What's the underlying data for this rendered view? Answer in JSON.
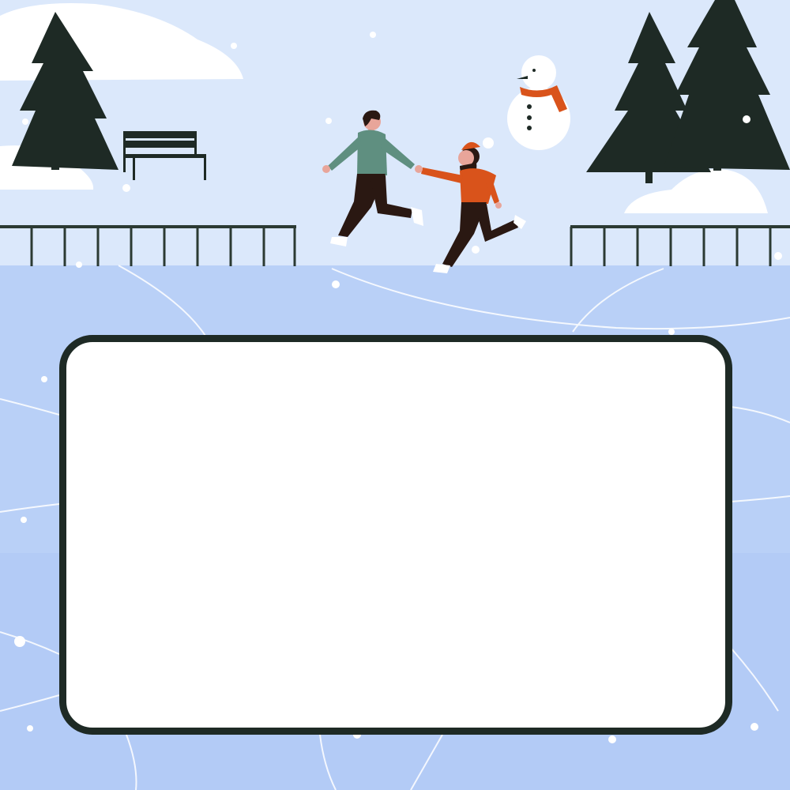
{
  "scene": {
    "sky_color": "#dbe8fb",
    "ice_color": "#b9d0f7",
    "snow_color": "#ffffff",
    "tree_color": "#1e2a25",
    "fence_color": "#2b3a33",
    "skater_male_sweater": "#5f8f80",
    "skater_female_sweater": "#d9531b",
    "pants_color": "#2a1812",
    "snowman_scarf": "#d9531b"
  },
  "card": {
    "background": "#ffffff",
    "border_color": "#1e2a25"
  }
}
